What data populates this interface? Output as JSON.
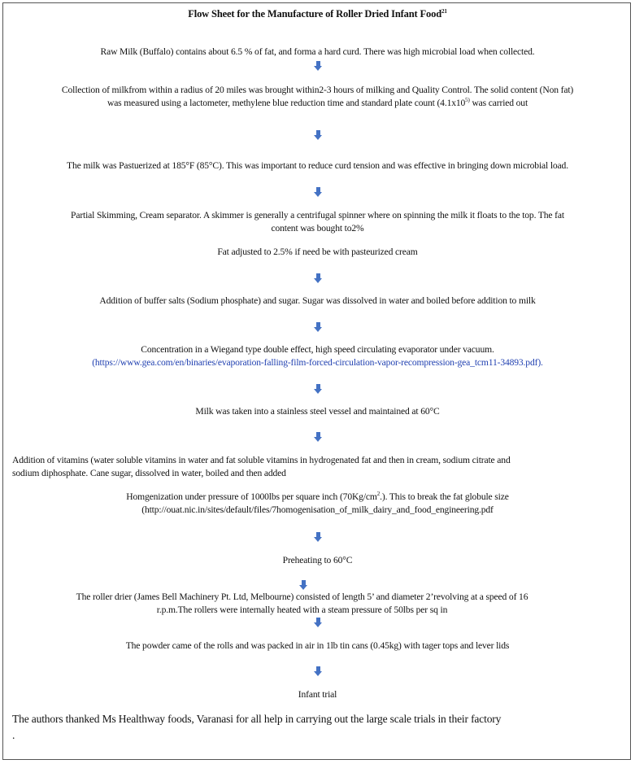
{
  "title": {
    "text": "Flow Sheet for the Manufacture of Roller Dried Infant Food",
    "ref": "21"
  },
  "steps": {
    "s1": "Raw Milk (Buffalo) contains about 6.5 % of fat, and forma a hard curd. There was high microbial load when collected.",
    "s2_a": "Collection of milkfrom within a radius of 20 miles was brought within2-3 hours of milking  and Quality Control. The solid content (Non fat)",
    "s2_b": "was measured using a lactometer, methylene blue reduction time and standard plate count  (4.1x10",
    "s2_sup": "5)",
    "s2_c": " was carried out",
    "s3": "The milk was Pastuerized at 185°F (85°C). This was important to reduce curd tension and was effective in bringing down microbial load.",
    "s4_a": "Partial Skimming, Cream separator. A skimmer is generally a centrifugal spinner where on spinning the milk it floats to the top. The fat",
    "s4_b": "content was bought to2%",
    "s5": "Fat adjusted to 2.5% if need be with pasteurized cream",
    "s6": "Addition of buffer salts (Sodium phosphate) and sugar. Sugar was dissolved in water and  boiled before addition to  milk",
    "s7_a": "Concentration in a Wiegand type double effect, high speed circulating evaporator under vacuum.",
    "s7_link": "(https://www.gea.com/en/binaries/evaporation-falling-film-forced-circulation-vapor-recompression-gea_tcm11-34893.pdf).",
    "s8": "Milk was taken into a stainless steel vessel and maintained at 60°C",
    "s9_a": "Addition of  vitamins (water soluble vitamins in water and fat soluble vitamins in hydrogenated fat and then in  cream, sodium citrate and",
    "s9_b": "sodium diphosphate. Cane sugar, dissolved in water, boiled and then added",
    "s10_a": "Homgenization under pressure of 1000lbs per square inch (70Kg/cm",
    "s10_sup": "2",
    "s10_b": ".). This to break the fat globule size",
    "s10_c": "(http://ouat.nic.in/sites/default/files/7homogenisation_of_milk_dairy_and_food_engineering.pdf",
    "s11": "Preheating to 60°C",
    "s12_a": "The roller drier (James Bell Machinery Pt. Ltd, Melbourne) consisted of length 5’ and diameter 2’revolving at a speed of 16",
    "s12_b": "r.p.m.The rollers were internally heated with a steam pressure of 50lbs per sq in",
    "s13": "The powder came  of the rolls and was packed in air in 1lb tin cans (0.45kg)  with tager tops and lever lids",
    "s14": "Infant trial"
  },
  "footer": {
    "line1": "The authors thanked  Ms Healthway foods, Varanasi for all help in carrying out the large scale trials in their factory",
    "line2": "."
  },
  "colors": {
    "arrow": "#4472c4",
    "link": "#1f3fb0",
    "border": "#555555"
  },
  "icons": {
    "arrow": "down-arrow-icon"
  }
}
